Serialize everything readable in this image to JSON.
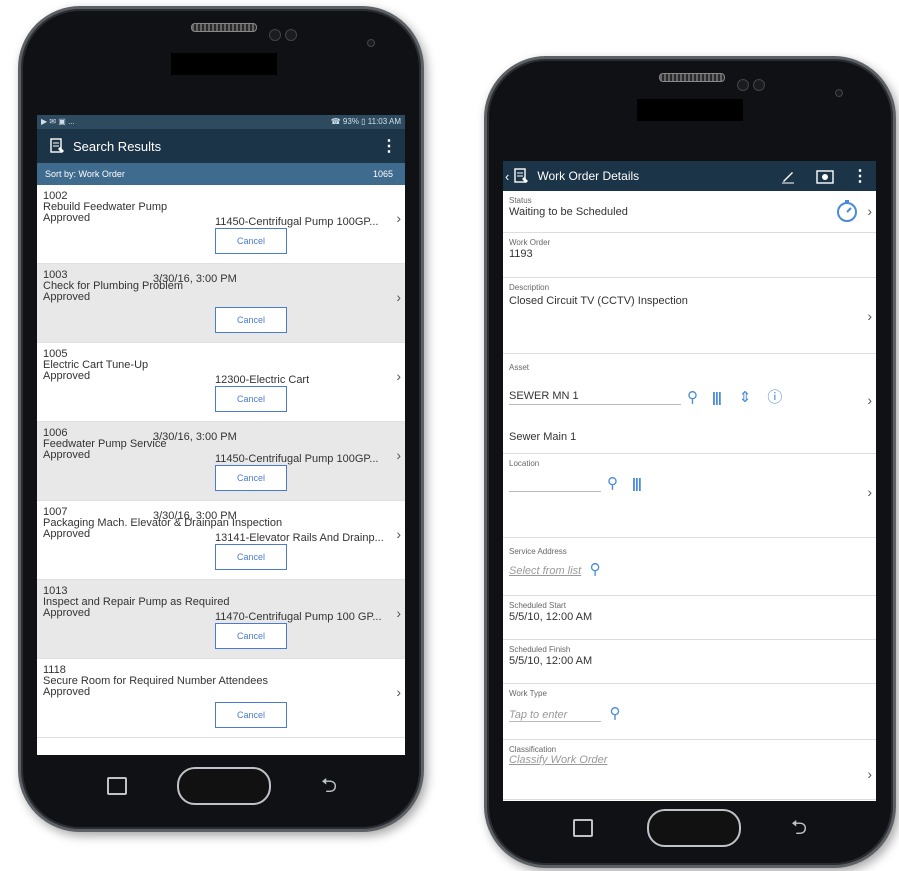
{
  "search_screen": {
    "status_bar": {
      "left": "▶ ✉ ▣ ...",
      "right": "☎ 93% ▯ 11:03 AM"
    },
    "title": "Search Results",
    "sort_label": "Sort by: Work Order",
    "count": "1065",
    "cancel_label": "Cancel",
    "rows": [
      {
        "num": "1002",
        "date": "",
        "desc": "Rebuild Feedwater Pump",
        "status": "Approved",
        "asset": "11450-Centrifugal Pump 100GP...",
        "alt": false
      },
      {
        "num": "1003",
        "date": "3/30/16, 3:00 PM",
        "desc": "Check for Plumbing Problem",
        "status": "Approved",
        "asset": "",
        "alt": true
      },
      {
        "num": "1005",
        "date": "",
        "desc": "Electric Cart Tune-Up",
        "status": "Approved",
        "asset": "12300-Electric Cart",
        "alt": false
      },
      {
        "num": "1006",
        "date": "3/30/16, 3:00 PM",
        "desc": "Feedwater Pump Service",
        "status": "Approved",
        "asset": "11450-Centrifugal Pump 100GP...",
        "alt": true
      },
      {
        "num": "1007",
        "date": "3/30/16, 3:00 PM",
        "desc": "Packaging Mach. Elevator & Drainpan Inspection",
        "status": "Approved",
        "asset": "13141-Elevator Rails And Drainp...",
        "alt": false
      },
      {
        "num": "1013",
        "date": "",
        "desc": "Inspect and Repair Pump as Required",
        "status": "Approved",
        "asset": "11470-Centrifugal Pump 100 GP...",
        "alt": true
      },
      {
        "num": "1118",
        "date": "",
        "desc": "Secure Room for Required Number Attendees",
        "status": "Approved",
        "asset": "",
        "alt": false
      }
    ]
  },
  "detail_screen": {
    "title": "Work Order Details",
    "status_label": "Status",
    "status_value": "Waiting to be Scheduled",
    "wo_label": "Work Order",
    "wo_value": "1193",
    "desc_label": "Description",
    "desc_value": "Closed Circuit TV (CCTV) Inspection",
    "asset_label": "Asset",
    "asset_value": "SEWER MN 1",
    "asset_desc": "Sewer Main 1",
    "location_label": "Location",
    "service_label": "Service Address",
    "service_placeholder": "Select from list",
    "sched_start_label": "Scheduled Start",
    "sched_start_value": "5/5/10, 12:00 AM",
    "sched_finish_label": "Scheduled Finish",
    "sched_finish_value": "5/5/10, 12:00 AM",
    "worktype_label": "Work Type",
    "worktype_placeholder": "Tap to enter",
    "class_label": "Classification",
    "class_placeholder": "Classify Work Order"
  },
  "colors": {
    "appbar": "#1c3448",
    "sortbar": "#3f6b8e",
    "accent": "#4a8ad8"
  }
}
